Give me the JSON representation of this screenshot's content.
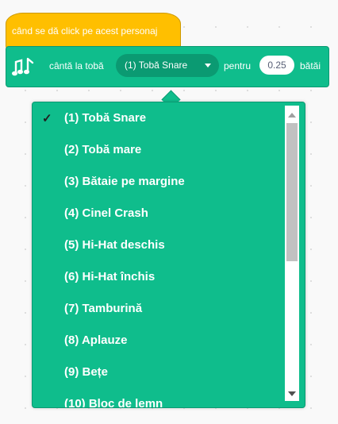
{
  "hat_block": {
    "label": "când se dă click pe acest personaj"
  },
  "music_block": {
    "icon": "music-note-icon",
    "text_play": "cântă la tobă",
    "selected_drum": "(1) Tobă Snare",
    "text_for": "pentru",
    "beats_value": "0.25",
    "text_beats": "bătăi"
  },
  "drum_menu": {
    "selected_index": 0,
    "check_mark": "✓",
    "items": [
      "(1) Tobă Snare",
      "(2) Tobă mare",
      "(3) Bătaie pe margine",
      "(4) Cinel Crash",
      "(5) Hi-Hat deschis",
      "(6) Hi-Hat închis",
      "(7) Tamburină",
      "(8) Aplauze",
      "(9) Bețe",
      "(10) Bloc de lemn"
    ]
  },
  "colors": {
    "events": "#ffbf00",
    "music": "#0fbd8c",
    "music_dark": "#0b9a72"
  }
}
